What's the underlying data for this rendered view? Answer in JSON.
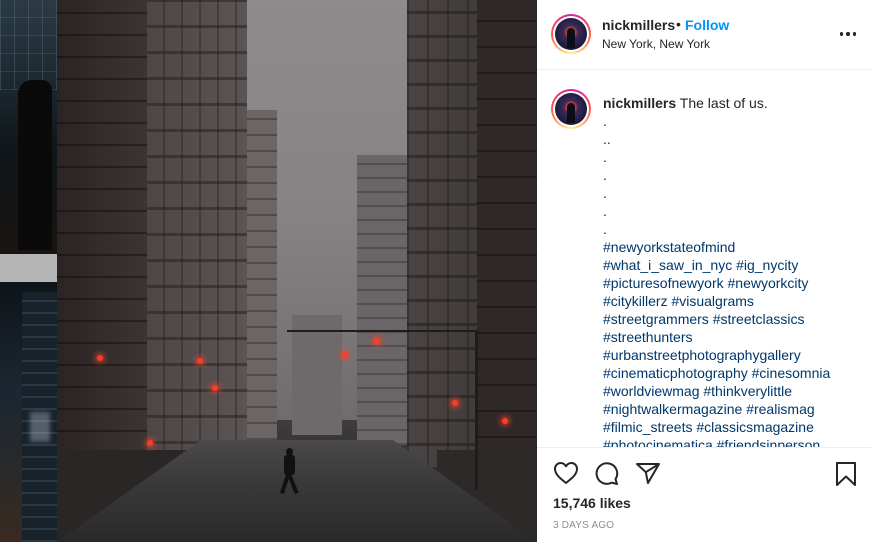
{
  "post": {
    "author": {
      "username": "nickmillers",
      "location": "New York, New York"
    },
    "follow_dot": "•",
    "follow_label": "Follow",
    "caption": {
      "username": "nickmillers",
      "text": "The last of us.",
      "dot_lines": [
        ".",
        "..",
        ".",
        ".",
        ".",
        ".",
        "."
      ],
      "hashtag_lines": [
        "#newyorkstateofmind",
        "#what_i_saw_in_nyc #ig_nycity",
        "#picturesofnewyork #newyorkcity",
        "#citykillerz #visualgrams",
        "#streetgrammers #streetclassics",
        "#streethunters",
        "#urbanstreetphotographygallery",
        "#cinematicphotography #cinesomnia",
        "#worldviewmag #thinkverylittle",
        "#nightwalkermagazine #realismag",
        "#filmic_streets #classicsmagazine",
        "#photocinematica #friendsinperson"
      ]
    },
    "likes": "15,746 likes",
    "timestamp": "3 DAYS AGO",
    "icons": {
      "more": "more-options-icon",
      "like": "heart-icon",
      "comment": "comment-bubble-icon",
      "share": "paper-plane-icon",
      "save": "bookmark-icon"
    },
    "colors": {
      "follow": "#0095f6",
      "hashtag": "#00376b",
      "text": "#262626",
      "muted": "#8e8e8e"
    }
  }
}
